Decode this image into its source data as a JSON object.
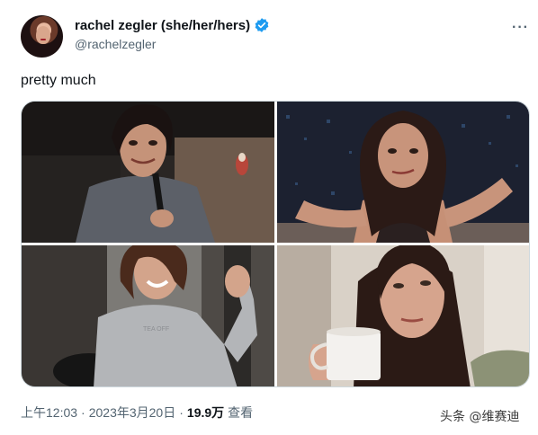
{
  "author": {
    "name": "rachel zegler (she/her/hers)",
    "handle": "@rachelzegler",
    "avatar_icon": "profile-avatar",
    "verified_icon": "verified-badge-icon",
    "verified_color": "#1d9bf0"
  },
  "more_label": "···",
  "tweet": {
    "text": "pretty much"
  },
  "media": [
    {
      "icon": "photo-woman-with-microphone"
    },
    {
      "icon": "photo-woman-shrugging"
    },
    {
      "icon": "photo-woman-waving"
    },
    {
      "icon": "photo-woman-with-mug"
    }
  ],
  "meta": {
    "time": "上午12:03",
    "separator1": "·",
    "date": "2023年3月20日",
    "separator2": "·",
    "views_count": "19.9万",
    "views_label": "查看"
  },
  "watermark": {
    "text": "头条 @维赛迪"
  }
}
